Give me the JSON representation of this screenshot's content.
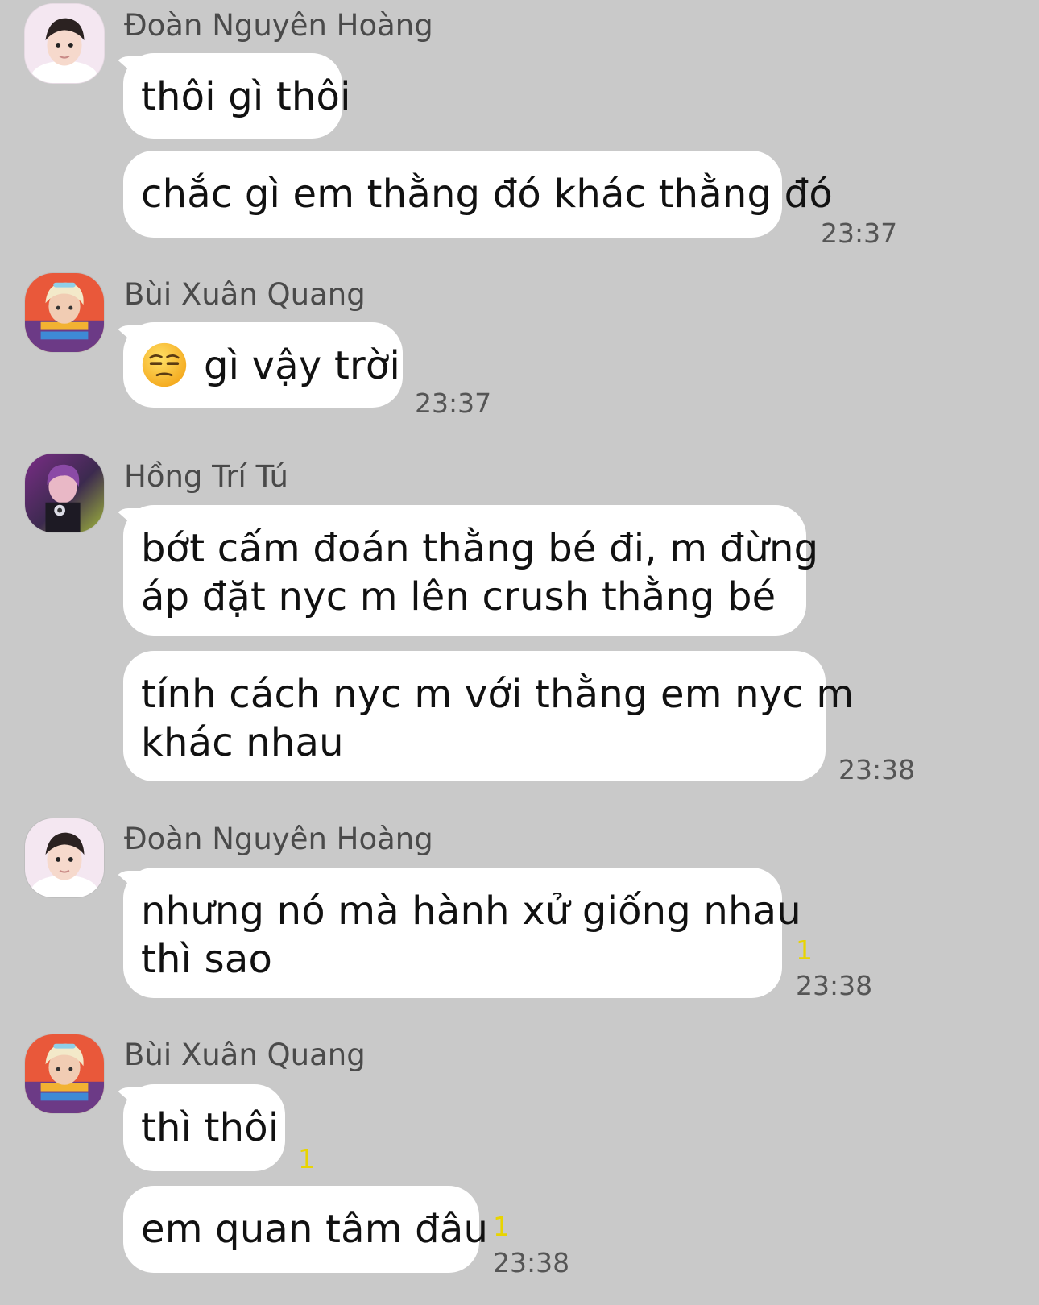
{
  "messages": [
    {
      "sender": "Đoàn Nguyên Hoàng",
      "bubbles": [
        "thôi gì thôi",
        "chắc gì em thằng đó khác thằng đó"
      ],
      "time": "23:37"
    },
    {
      "sender": "Bùi Xuân Quang",
      "emoji": "unamused-face",
      "bubbles": [
        "gì vậy trời"
      ],
      "time": "23:37"
    },
    {
      "sender": "Hồng Trí Tú",
      "bubbles": [
        [
          "bớt cấm đoán thằng bé đi, m đừng",
          "áp đặt nyc m lên crush thằng bé"
        ],
        [
          "tính cách nyc m với thằng em nyc m",
          "khác nhau"
        ]
      ],
      "time": "23:38"
    },
    {
      "sender": "Đoàn Nguyên Hoàng",
      "bubbles": [
        [
          "nhưng nó mà hành xử giống nhau",
          "thì sao"
        ]
      ],
      "unread": "1",
      "time": "23:38"
    },
    {
      "sender": "Bùi Xuân Quang",
      "bubbles": [
        "thì thôi",
        "em quan tâm đâu"
      ],
      "unread": [
        "1",
        "1"
      ],
      "time": "23:38"
    }
  ],
  "colors": {
    "background": "#c9c9c9",
    "bubble": "#ffffff",
    "sender_name": "#4a4a4a",
    "time": "#555555",
    "unread_count": "#e8d400"
  }
}
